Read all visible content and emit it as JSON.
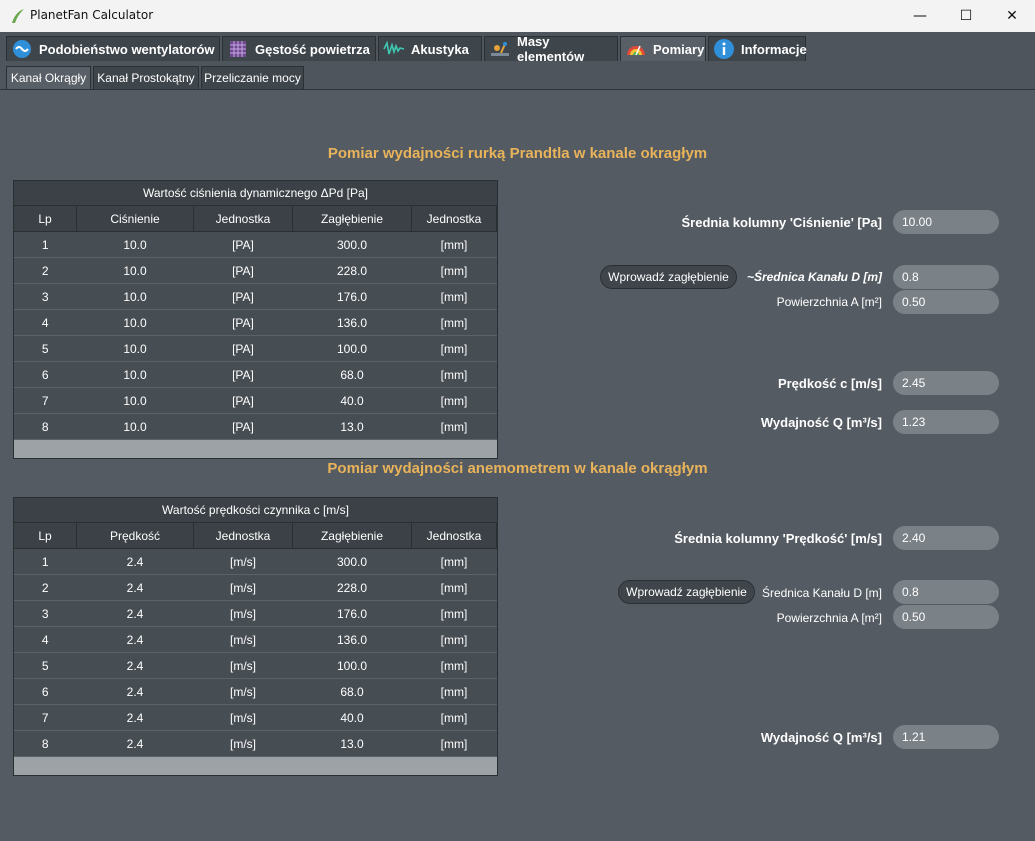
{
  "window": {
    "title": "PlanetFan Calculator",
    "minimize": "—",
    "maximize": "☐",
    "close": "✕"
  },
  "main_tabs": [
    {
      "label": "Podobieństwo wentylatorów",
      "icon": "fan-similarity-icon"
    },
    {
      "label": "Gęstość powietrza",
      "icon": "air-density-icon"
    },
    {
      "label": "Akustyka",
      "icon": "acoustics-wave-icon"
    },
    {
      "label": "Masy elementów",
      "icon": "mass-icon"
    },
    {
      "label": "Pomiary",
      "icon": "gauge-icon"
    },
    {
      "label": "Informacje",
      "icon": "info-icon"
    }
  ],
  "sub_tabs": [
    {
      "label": "Kanał Okrągły"
    },
    {
      "label": "Kanał Prostokątny"
    },
    {
      "label": "Przeliczanie mocy"
    }
  ],
  "colors": {
    "accent": "#e8b35a",
    "background": "#545b62"
  },
  "section1": {
    "title": "Pomiar wydajności rurką Prandtla w kanale okragłym",
    "table": {
      "caption": "Wartość ciśnienia dynamicznego ΔPd [Pa]",
      "headers": [
        "Lp",
        "Ciśnienie",
        "Jednostka",
        "Zagłębienie",
        "Jednostka"
      ],
      "rows": [
        [
          "1",
          "10.0",
          "[PA]",
          "300.0",
          "[mm]"
        ],
        [
          "2",
          "10.0",
          "[PA]",
          "228.0",
          "[mm]"
        ],
        [
          "3",
          "10.0",
          "[PA]",
          "176.0",
          "[mm]"
        ],
        [
          "4",
          "10.0",
          "[PA]",
          "136.0",
          "[mm]"
        ],
        [
          "5",
          "10.0",
          "[PA]",
          "100.0",
          "[mm]"
        ],
        [
          "6",
          "10.0",
          "[PA]",
          "68.0",
          "[mm]"
        ],
        [
          "7",
          "10.0",
          "[PA]",
          "40.0",
          "[mm]"
        ],
        [
          "8",
          "10.0",
          "[PA]",
          "13.0",
          "[mm]"
        ]
      ]
    },
    "avg_label": "Średnia kolumny 'Ciśnienie' [Pa]",
    "avg_value": "10.00",
    "button": "Wprowadź zagłębienie",
    "diameter_label": "~Średnica Kanału D [m]",
    "diameter_value": "0.8",
    "area_label": "Powierzchnia A [m²]",
    "area_value": "0.50",
    "speed_label": "Prędkość c [m/s]",
    "speed_value": "2.45",
    "flow_label": "Wydajność Q [m³/s]",
    "flow_value": "1.23"
  },
  "section2": {
    "title": "Pomiar wydajności anemometrem w kanale okrągłym",
    "table": {
      "caption": "Wartość prędkości czynnika c [m/s]",
      "headers": [
        "Lp",
        "Prędkość",
        "Jednostka",
        "Zagłębienie",
        "Jednostka"
      ],
      "rows": [
        [
          "1",
          "2.4",
          "[m/s]",
          "300.0",
          "[mm]"
        ],
        [
          "2",
          "2.4",
          "[m/s]",
          "228.0",
          "[mm]"
        ],
        [
          "3",
          "2.4",
          "[m/s]",
          "176.0",
          "[mm]"
        ],
        [
          "4",
          "2.4",
          "[m/s]",
          "136.0",
          "[mm]"
        ],
        [
          "5",
          "2.4",
          "[m/s]",
          "100.0",
          "[mm]"
        ],
        [
          "6",
          "2.4",
          "[m/s]",
          "68.0",
          "[mm]"
        ],
        [
          "7",
          "2.4",
          "[m/s]",
          "40.0",
          "[mm]"
        ],
        [
          "8",
          "2.4",
          "[m/s]",
          "13.0",
          "[mm]"
        ]
      ]
    },
    "avg_label": "Średnia kolumny 'Prędkość' [m/s]",
    "avg_value": "2.40",
    "button": "Wprowadź zagłębienie",
    "diameter_label": "Średnica Kanału D [m]",
    "diameter_value": "0.8",
    "area_label": "Powierzchnia A [m²]",
    "area_value": "0.50",
    "flow_label": "Wydajność Q [m³/s]",
    "flow_value": "1.21"
  }
}
